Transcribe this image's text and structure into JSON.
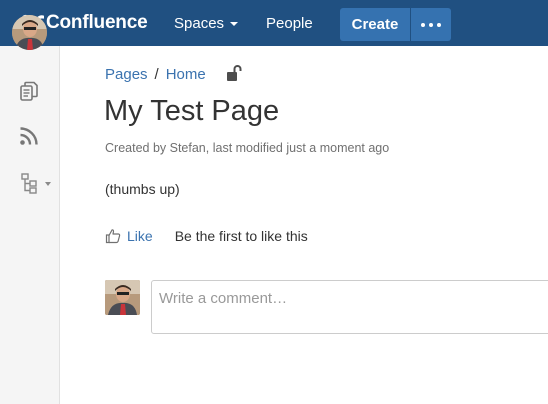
{
  "header": {
    "logo_text": "Confluence",
    "nav": {
      "spaces_label": "Spaces",
      "people_label": "People"
    },
    "create_label": "Create",
    "more_icon": "ellipsis-icon"
  },
  "sidebar": {
    "avatar": "user-avatar",
    "icons": [
      "pages-icon",
      "feed-icon",
      "page-tree-icon"
    ]
  },
  "breadcrumb": {
    "items": [
      "Pages",
      "Home"
    ],
    "separator": "/",
    "lock_icon": "unlocked-padlock-icon"
  },
  "page": {
    "title": "My Test Page",
    "meta_prefix": "Created by ",
    "author": "Stefan",
    "meta_mid": ", last modified ",
    "modified": "just a moment ago",
    "body": "(thumbs up)"
  },
  "likes": {
    "like_label": "Like",
    "hint": "Be the first to like this"
  },
  "comment": {
    "placeholder": "Write a comment…"
  },
  "colors": {
    "header_bg": "#205081",
    "button_bg": "#3572b0",
    "link": "#3b73af",
    "sidebar_bg": "#f5f5f5"
  }
}
